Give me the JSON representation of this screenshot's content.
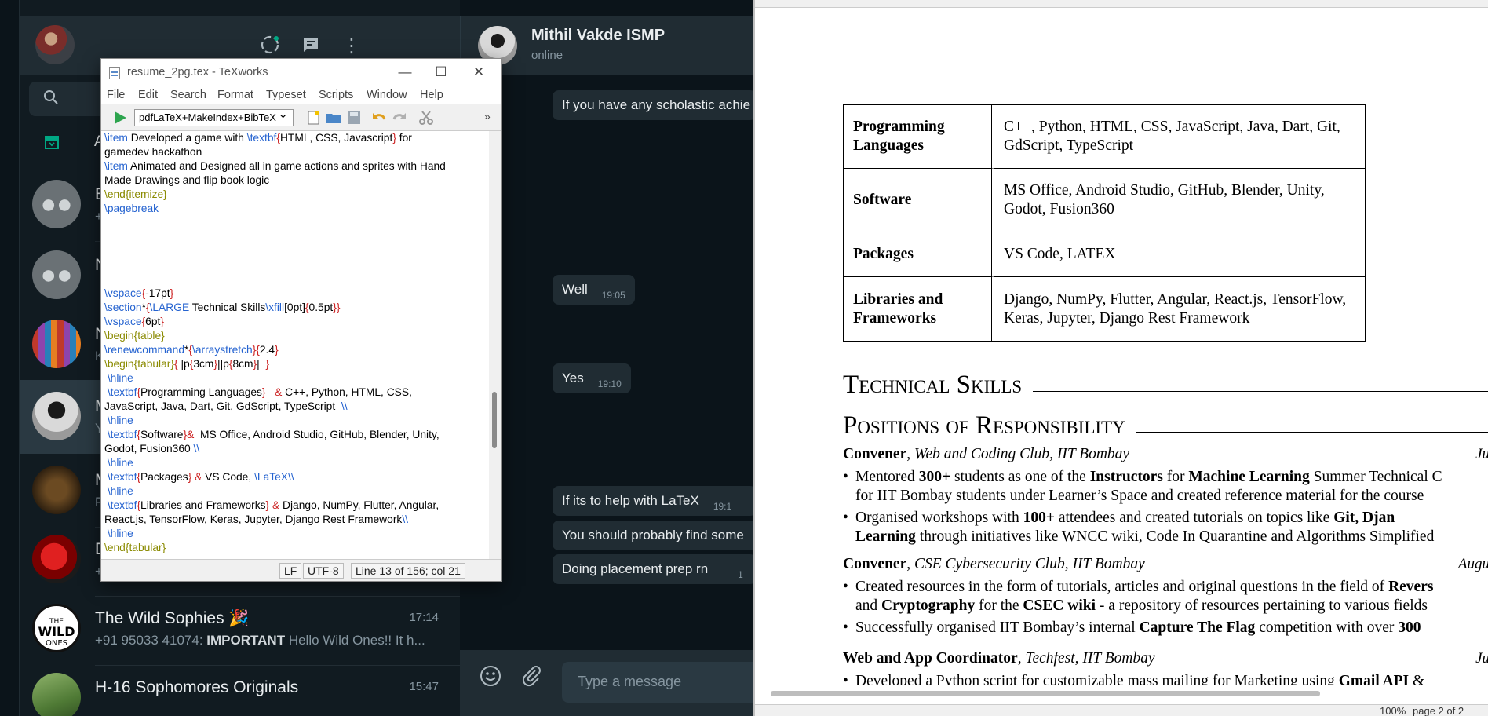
{
  "whatsapp": {
    "search_placeholder": "S",
    "archived_label": "A",
    "chats": [
      {
        "name": "E",
        "preview": "+",
        "time": ""
      },
      {
        "name": "N",
        "preview": "",
        "time": ""
      },
      {
        "name": "N",
        "preview": "K",
        "time": ""
      },
      {
        "name": "M",
        "preview": "Y",
        "time": ""
      },
      {
        "name": "M",
        "preview": "P",
        "time": ""
      },
      {
        "name": "D",
        "preview": "+",
        "time": ""
      },
      {
        "name": "The Wild Sophies 🎉",
        "preview_sender": "+91 95033 41074:",
        "preview_bold": "IMPORTANT",
        "preview": "Hello Wild Ones!! It h...",
        "time": "17:14"
      },
      {
        "name": "H-16 Sophomores Originals",
        "preview": "",
        "time": "15:47"
      }
    ],
    "active_chat": {
      "name": "Mithil Vakde ISMP",
      "status": "online"
    },
    "messages": [
      {
        "text": "If you have any scholastic achie",
        "time": ""
      },
      {
        "text": "Well",
        "time": "19:05"
      },
      {
        "text": "Yes",
        "time": "19:10"
      },
      {
        "text": "If its to help with LaTeX",
        "time": "19:1"
      },
      {
        "text": "You should probably find some",
        "time": ""
      },
      {
        "text": "Doing placement prep rn",
        "time": "1"
      }
    ],
    "input_placeholder": "Type a message"
  },
  "texworks": {
    "title": "resume_2pg.tex - TeXworks",
    "menu": [
      "File",
      "Edit",
      "Search",
      "Format",
      "Typeset",
      "Scripts",
      "Window",
      "Help"
    ],
    "engine": "pdfLaTeX+MakeIndex+BibTeX",
    "status": {
      "eol": "LF",
      "encoding": "UTF-8",
      "position": "Line 13 of 156; col 21"
    }
  },
  "pdf": {
    "skills_table": [
      {
        "key": "Programming Languages",
        "value": "C++, Python, HTML, CSS, JavaScript, Java, Dart, Git, GdScript, TypeScript"
      },
      {
        "key": "Software",
        "value": "MS Office, Android Studio, GitHub, Blender, Unity, Godot, Fusion360"
      },
      {
        "key": "Packages",
        "value": "VS Code, LATEX"
      },
      {
        "key": "Libraries and Frameworks",
        "value": "Django, NumPy, Flutter, Angular, React.js, TensorFlow, Keras, Jupyter, Django Rest Framework"
      }
    ],
    "section_technical": "Technical Skills",
    "section_positions": "Positions of Responsibility",
    "positions": [
      {
        "role": "Convener",
        "org": "Web and Coding Club, IIT Bombay",
        "date": "Ju"
      },
      {
        "role": "Convener",
        "org": "CSE Cybersecurity Club, IIT Bombay",
        "date": "Augu"
      },
      {
        "role": "Web and App Coordinator",
        "org": "Techfest, IIT Bombay",
        "date": "Ju"
      }
    ],
    "zoom": "100%",
    "page": "page 2 of 2"
  }
}
